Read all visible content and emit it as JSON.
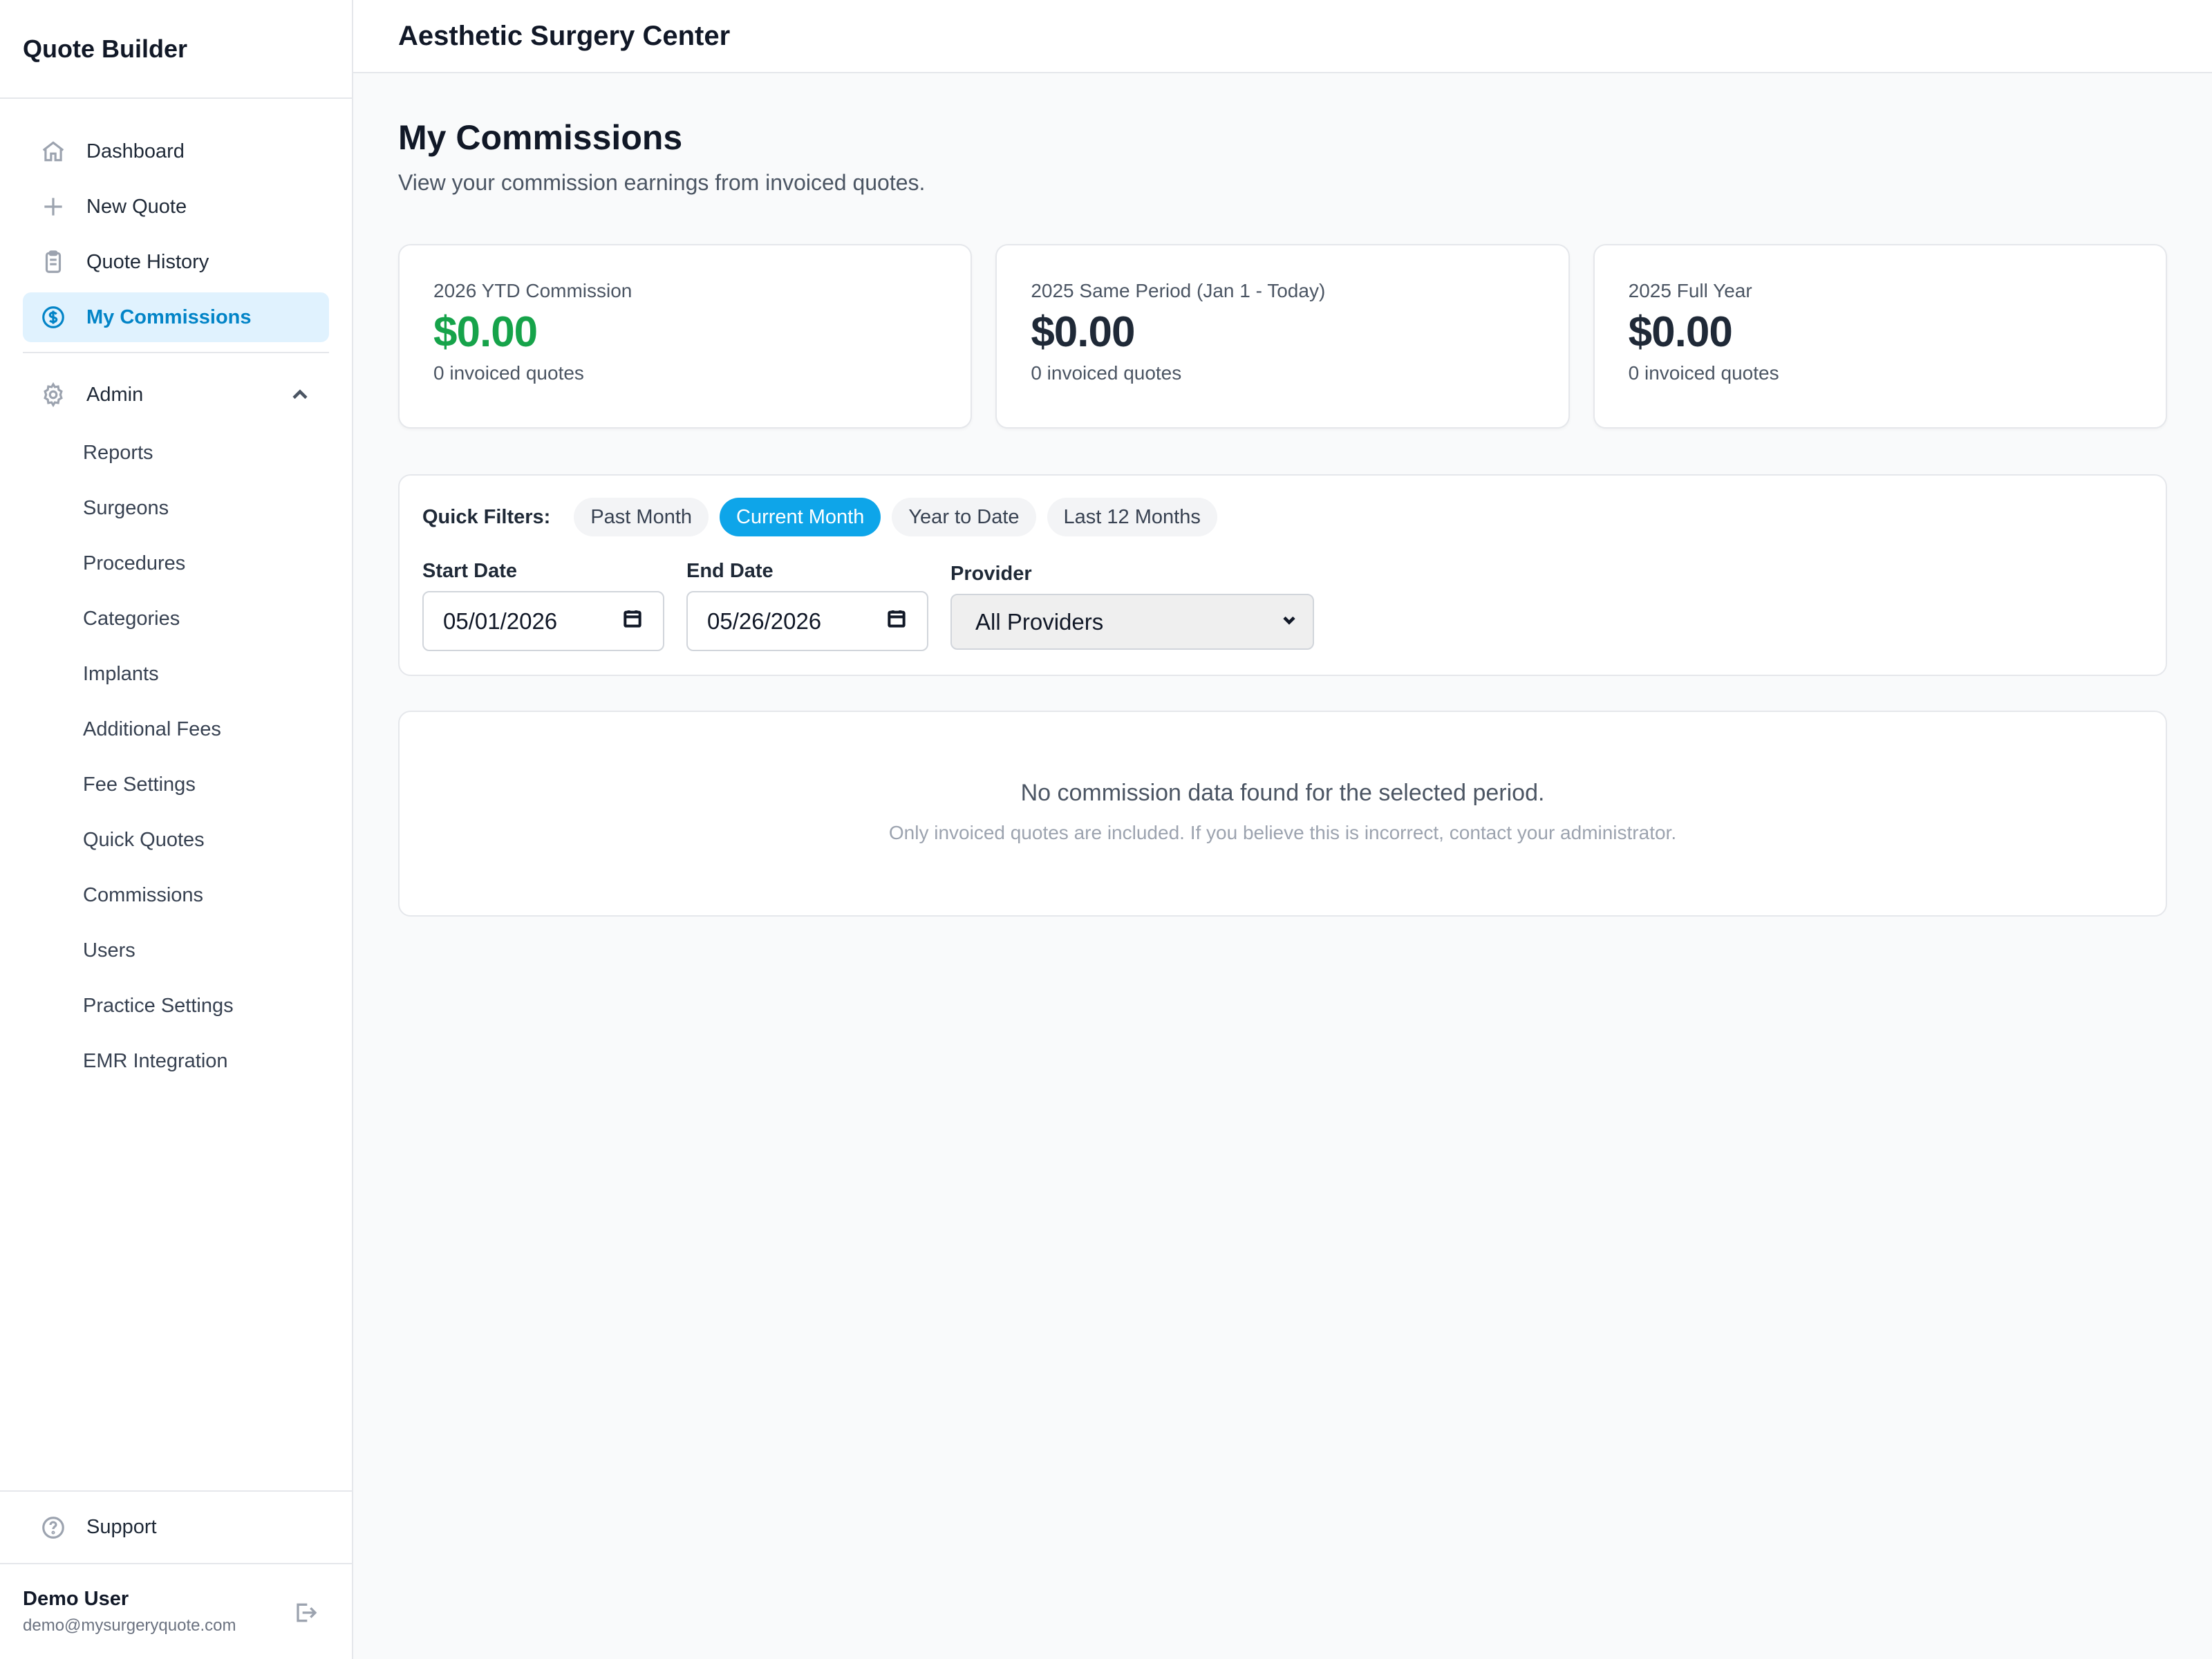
{
  "sidebar": {
    "brand": "Quote Builder",
    "nav": [
      {
        "label": "Dashboard",
        "icon": "home-icon"
      },
      {
        "label": "New Quote",
        "icon": "plus-icon"
      },
      {
        "label": "Quote History",
        "icon": "clipboard-icon"
      },
      {
        "label": "My Commissions",
        "icon": "dollar-circle-icon",
        "active": true
      }
    ],
    "admin": {
      "label": "Admin",
      "items": [
        "Reports",
        "Surgeons",
        "Procedures",
        "Categories",
        "Implants",
        "Additional Fees",
        "Fee Settings",
        "Quick Quotes",
        "Commissions",
        "Users",
        "Practice Settings",
        "EMR Integration"
      ]
    },
    "support": "Support",
    "user": {
      "name": "Demo User",
      "email": "demo@mysurgeryquote.com"
    }
  },
  "header": {
    "org": "Aesthetic Surgery Center"
  },
  "page": {
    "title": "My Commissions",
    "subtitle": "View your commission earnings from invoiced quotes."
  },
  "cards": [
    {
      "label": "2026 YTD Commission",
      "value": "$0.00",
      "count": "0 invoiced quotes",
      "accent": "#16a34a"
    },
    {
      "label": "2025 Same Period (Jan 1 - Today)",
      "value": "$0.00",
      "count": "0 invoiced quotes"
    },
    {
      "label": "2025 Full Year",
      "value": "$0.00",
      "count": "0 invoiced quotes"
    }
  ],
  "filters": {
    "quick_label": "Quick Filters:",
    "quick": [
      "Past Month",
      "Current Month",
      "Year to Date",
      "Last 12 Months"
    ],
    "active_quick": "Current Month",
    "start_label": "Start Date",
    "start_value": "05/01/2026",
    "end_label": "End Date",
    "end_value": "05/26/2026",
    "provider_label": "Provider",
    "provider_value": "All Providers"
  },
  "empty": {
    "title": "No commission data found for the selected period.",
    "subtitle": "Only invoiced quotes are included. If you believe this is incorrect, contact your administrator."
  },
  "colors": {
    "accent": "#0ea5e9",
    "active_nav_bg": "#e0f2fe",
    "green": "#16a34a"
  }
}
